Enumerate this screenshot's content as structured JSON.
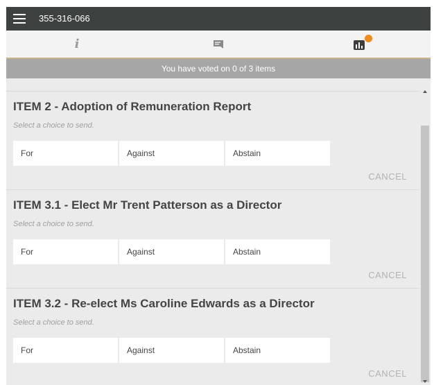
{
  "header": {
    "meeting_id": "355-316-066",
    "menu_icon": "hamburger-menu-icon",
    "background_color": "#3d4240"
  },
  "tabs": [
    {
      "name": "info",
      "icon": "info-icon",
      "glyph": "i",
      "active": false
    },
    {
      "name": "chat",
      "icon": "chat-bubble-icon",
      "active": false
    },
    {
      "name": "voting",
      "icon": "bar-chart-icon",
      "active": true,
      "badge_color": "#f08c1e"
    }
  ],
  "status": {
    "text": "You have voted on 0 of 3 items"
  },
  "items": [
    {
      "title": "ITEM 2 - Adoption of Remuneration Report",
      "hint": "Select a choice to send.",
      "choices": [
        "For",
        "Against",
        "Abstain"
      ],
      "cancel_label": "CANCEL"
    },
    {
      "title": "ITEM 3.1 - Elect Mr Trent Patterson as a Director",
      "hint": "Select a choice to send.",
      "choices": [
        "For",
        "Against",
        "Abstain"
      ],
      "cancel_label": "CANCEL"
    },
    {
      "title": "ITEM 3.2 - Re-elect Ms Caroline Edwards as a Director",
      "hint": "Select a choice to send.",
      "choices": [
        "For",
        "Against",
        "Abstain"
      ],
      "cancel_label": "CANCEL"
    }
  ],
  "colors": {
    "accent_underline": "#c8b48a",
    "status_bar": "#a6a6a6",
    "badge": "#f08c1e"
  }
}
